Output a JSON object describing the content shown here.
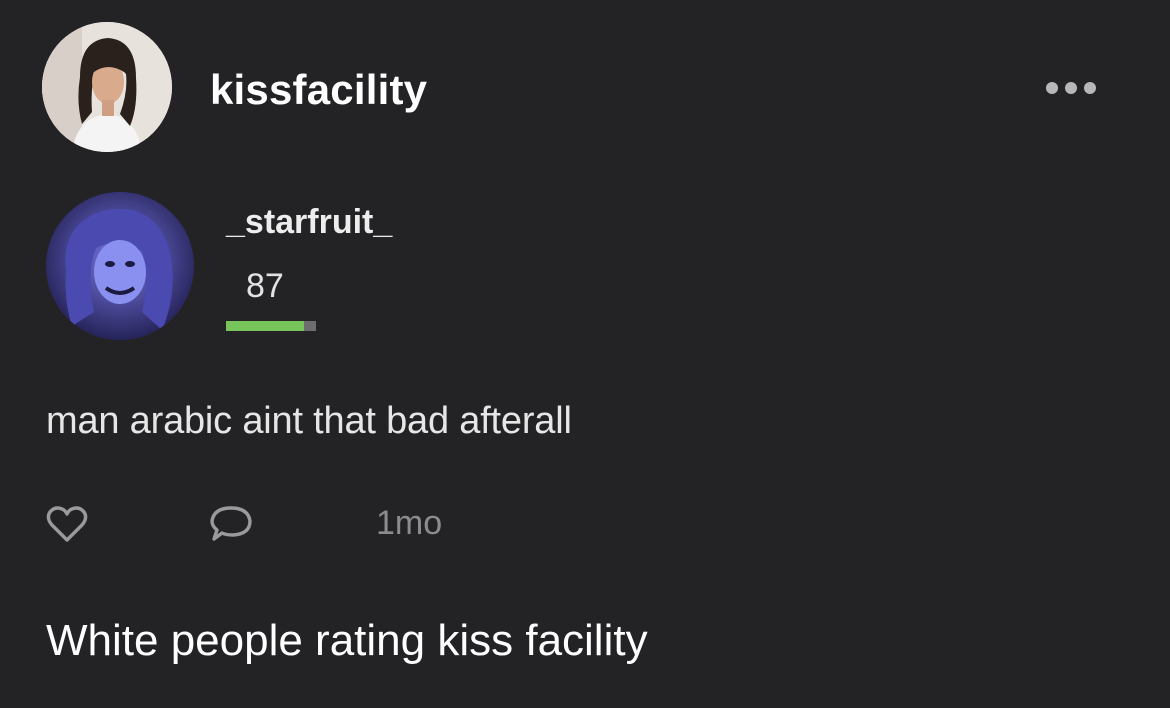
{
  "post": {
    "author": {
      "username": "kissfacility",
      "avatar": "profile-photo"
    },
    "more_icon": "ellipsis-icon",
    "quoted": {
      "username": "_starfruit_",
      "avatar": "profile-photo",
      "score": "87",
      "score_bar_fraction": 0.87,
      "text": "man arabic aint that bad afterall",
      "like_icon": "heart-icon",
      "comment_icon": "comment-icon",
      "time": "1mo"
    },
    "caption": "White people rating kiss facility"
  },
  "colors": {
    "background": "#232326",
    "bar_fill": "#77c45a",
    "bar_track": "#6d6d70",
    "muted_text": "#8c8c90"
  }
}
